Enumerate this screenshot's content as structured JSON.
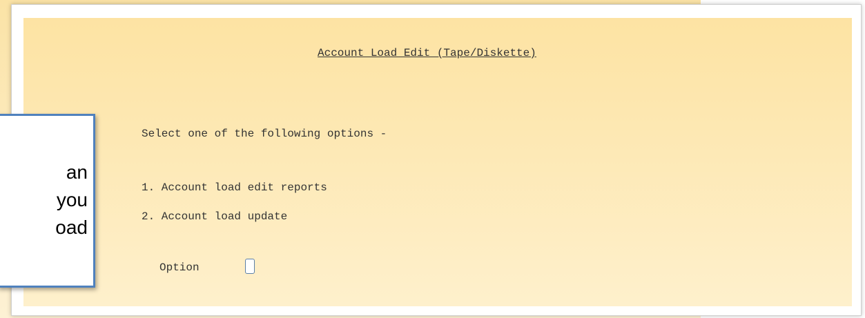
{
  "screen": {
    "title": "Account Load Edit (Tape/Diskette)",
    "prompt": "Select one of the following options -",
    "options": [
      {
        "label": "1. Account load edit reports"
      },
      {
        "label": "2. Account load update"
      }
    ],
    "option_label": "Option",
    "option_value": ""
  },
  "callout": {
    "lines": [
      "an",
      "you",
      "oad"
    ]
  },
  "colors": {
    "screen_bg": "#fde3a3",
    "callout_border": "#4f81bd",
    "input_border": "#5b7fa6"
  }
}
